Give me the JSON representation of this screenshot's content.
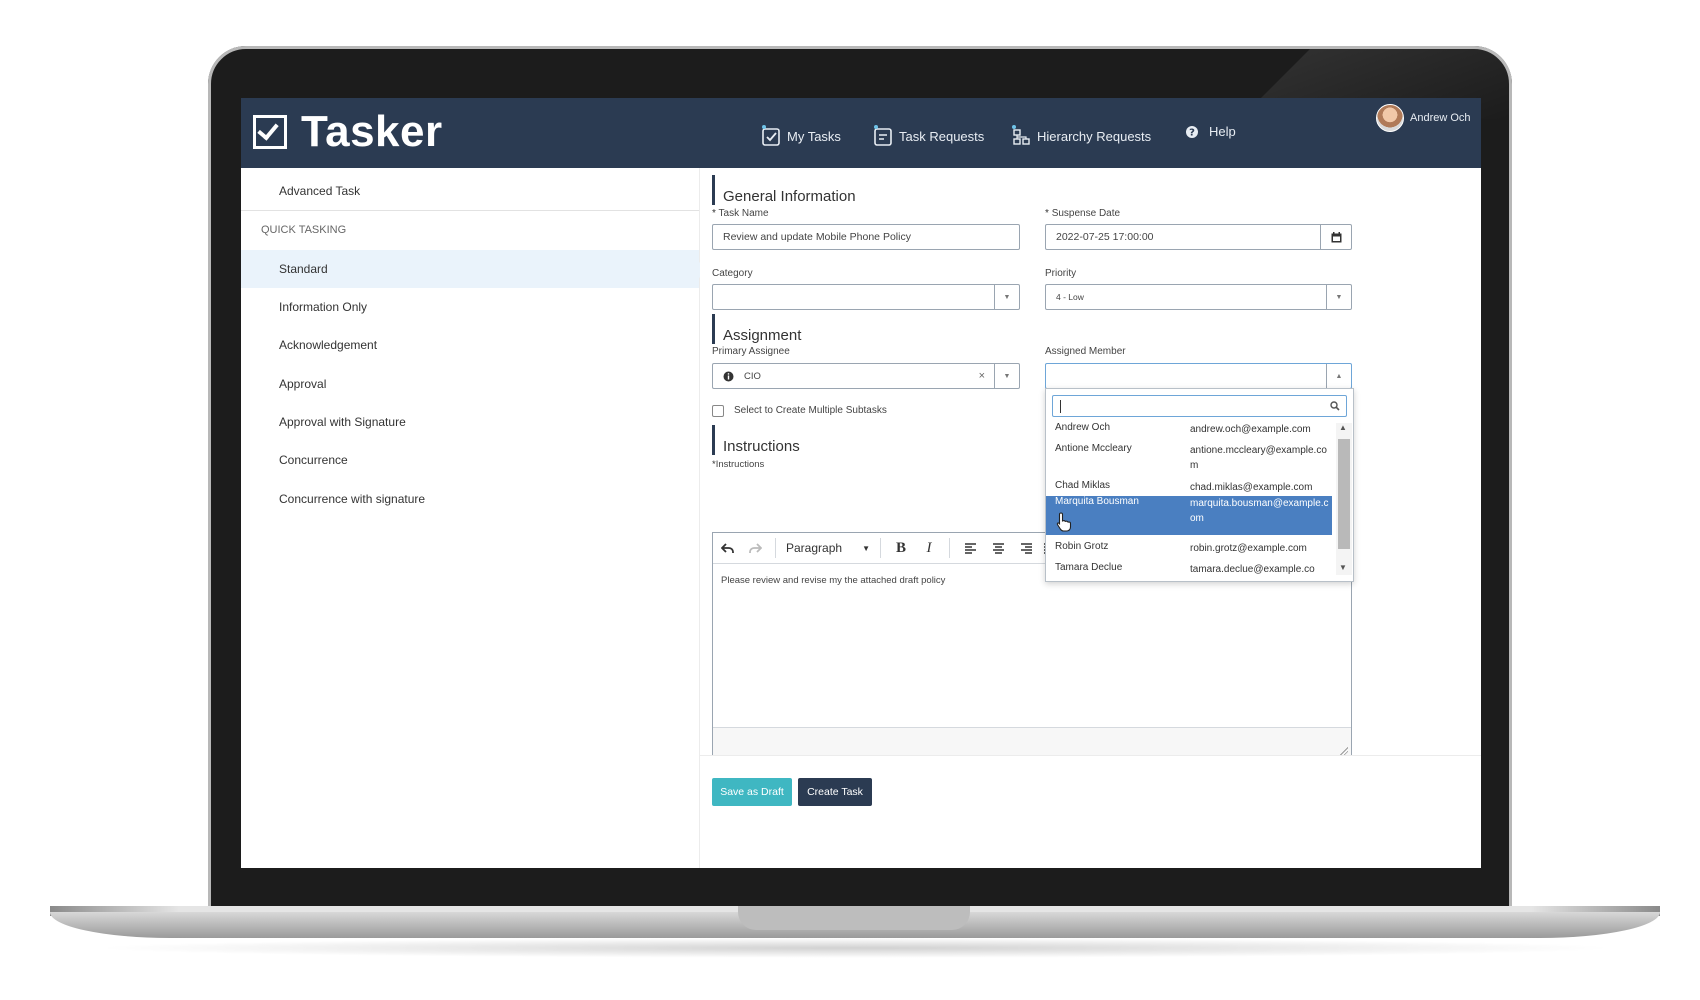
{
  "app": {
    "name": "Tasker",
    "user_name": "Andrew Och"
  },
  "nav": {
    "my_tasks": "My Tasks",
    "task_requests": "Task Requests",
    "hierarchy_requests": "Hierarchy Requests",
    "help": "Help"
  },
  "sidebar": {
    "advanced_task": "Advanced Task",
    "quick_header": "QUICK TASKING",
    "items": [
      {
        "label": "Standard",
        "active": true
      },
      {
        "label": "Information Only"
      },
      {
        "label": "Acknowledgement"
      },
      {
        "label": "Approval"
      },
      {
        "label": "Approval with Signature"
      },
      {
        "label": "Concurrence"
      },
      {
        "label": "Concurrence with signature"
      }
    ]
  },
  "form": {
    "general_section": "General Information",
    "task_name_label": "Task Name",
    "task_name_value": "Review and update Mobile Phone Policy",
    "suspense_label": "Suspense Date",
    "suspense_value": "2022-07-25 17:00:00",
    "category_label": "Category",
    "category_value": "",
    "priority_label": "Priority",
    "priority_value": "4 - Low",
    "assignment_section": "Assignment",
    "primary_assignee_label": "Primary Assignee",
    "primary_assignee_value": "CIO",
    "assigned_member_label": "Assigned Member",
    "assigned_member_value": "",
    "subtasks_label": "Select to Create Multiple Subtasks",
    "instructions_section": "Instructions",
    "instructions_label": "Instructions",
    "paragraph_format": "Paragraph",
    "instructions_text": "Please review and revise my the attached draft policy",
    "required_mark": "*"
  },
  "member_dropdown": {
    "options": [
      {
        "name": "Andrew Och",
        "email": "andrew.och@example.com"
      },
      {
        "name": "Antione Mccleary",
        "email": "antione.mccleary@example.com"
      },
      {
        "name": "Chad Miklas",
        "email": "chad.miklas@example.com"
      },
      {
        "name": "Marquita Bousman",
        "email": "marquita.bousman@example.com",
        "highlighted": true
      },
      {
        "name": "Robin Grotz",
        "email": "robin.grotz@example.com"
      },
      {
        "name": "Tamara Declue",
        "email": "tamara.declue@example.co"
      }
    ]
  },
  "actions": {
    "save_draft": "Save as Draft",
    "create_task": "Create Task"
  },
  "colors": {
    "header_bg": "#2b3b52",
    "draft_button": "#3fb7c2",
    "create_button": "#2b3b52",
    "highlight": "#4a7fc1",
    "active_item_bg": "#eaf3fb"
  },
  "icons": [
    "task-check-icon",
    "task-request-icon",
    "hierarchy-icon",
    "help-icon",
    "calendar-icon",
    "info-icon",
    "search-icon",
    "undo-icon",
    "redo-icon",
    "bold-icon",
    "italic-icon",
    "align-left-icon",
    "align-center-icon",
    "align-right-icon",
    "pointer-hand-icon"
  ]
}
